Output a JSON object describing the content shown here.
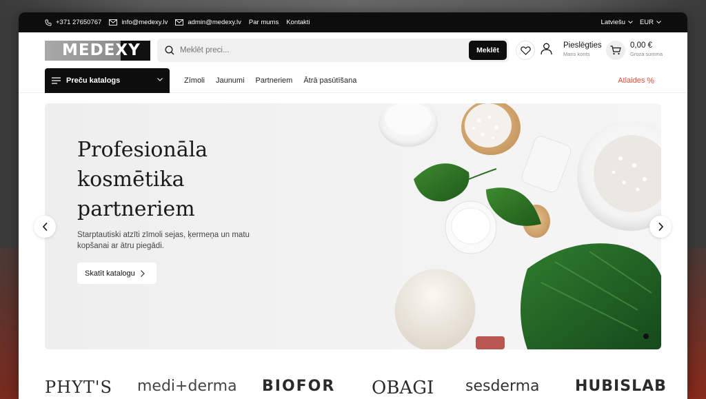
{
  "topbar": {
    "phone": "+371 27650767",
    "email1": "info@medexy.lv",
    "email2": "admin@medexy.lv",
    "links": [
      "Par mums",
      "Kontakti"
    ],
    "language": "Latviešu",
    "currency": "EUR"
  },
  "header": {
    "logo": "MEDEXY",
    "search_placeholder": "Meklēt preci...",
    "search_button": "Meklēt",
    "login_title": "Pieslēgties",
    "login_sub": "Mans konts",
    "cart_total": "0,00 €",
    "cart_sub": "Groza summa"
  },
  "nav": {
    "catalog": "Preču katalogs",
    "links": [
      "Zīmoli",
      "Jaunumi",
      "Partneriem",
      "Ātrā pasūtīšana"
    ],
    "sale": "Atlaides",
    "sale_icon": "%"
  },
  "hero": {
    "title_line1": "Profesionāla",
    "title_line2": "kosmētika",
    "title_line3": "partneriem",
    "text": "Starptautiski atzīti zīmoli sejas, ķermeņa un matu kopšanai ar ātru piegādi.",
    "button": "Skatīt katalogu"
  },
  "brands": [
    "PHYT'S",
    "medi+derma",
    "BIOFOR",
    "OBAGI",
    "sesderma",
    "HUBISLAB"
  ],
  "colors": {
    "accent": "#0d0d0d",
    "sale": "#e04a36"
  }
}
